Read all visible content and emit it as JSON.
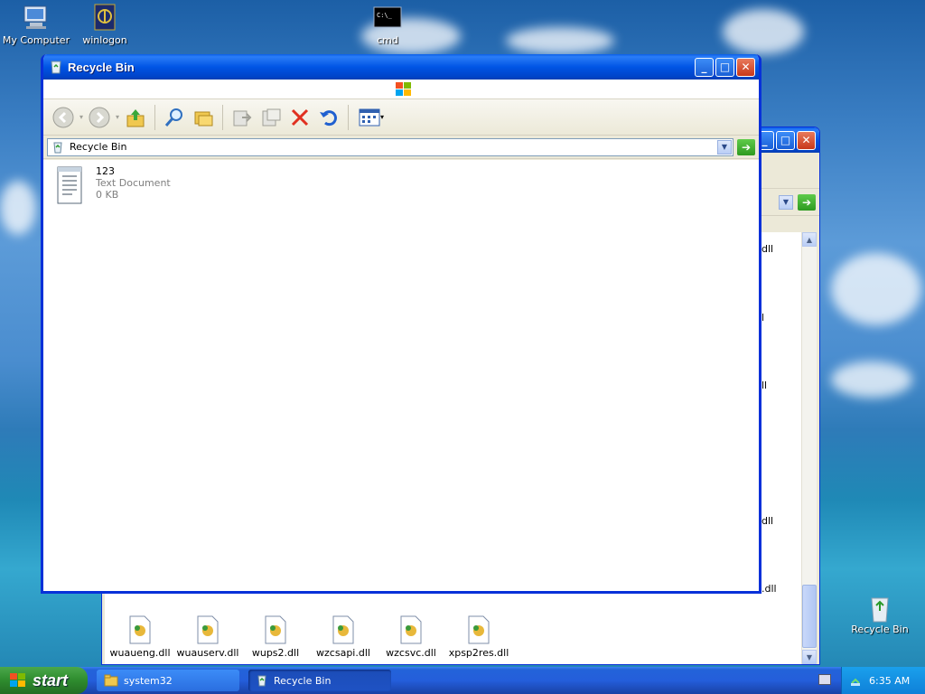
{
  "desktop": {
    "icons": [
      {
        "label": "My Computer",
        "icon": "my-computer-icon"
      },
      {
        "label": "winlogon",
        "icon": "winlogon-icon"
      },
      {
        "label": "cmd",
        "icon": "cmd-icon"
      },
      {
        "label": "Recycle Bin",
        "icon": "recycle-bin-icon"
      }
    ]
  },
  "back_window": {
    "title": "system32",
    "files": [
      {
        "name": "wuaueng.dll"
      },
      {
        "name": "wuauserv.dll"
      },
      {
        "name": "wups2.dll"
      },
      {
        "name": "wzcsapi.dll"
      },
      {
        "name": "wzcsvc.dll"
      },
      {
        "name": "xpsp2res.dll"
      }
    ],
    "partial_items": [
      {
        "text": "dll"
      },
      {
        "text": "l"
      },
      {
        "text": "ll"
      },
      {
        "text": "dll"
      },
      {
        "text": ".dll"
      }
    ]
  },
  "front_window": {
    "title": "Recycle Bin",
    "address": "Recycle Bin",
    "files": [
      {
        "name": "123",
        "type": "Text Document",
        "size": "0 KB"
      }
    ]
  },
  "taskbar": {
    "start_label": "start",
    "tasks": [
      {
        "label": "system32",
        "active": false
      },
      {
        "label": "Recycle Bin",
        "active": true
      }
    ],
    "clock": "6:35 AM"
  },
  "colors": {
    "xp_blue": "#0055e5",
    "start_green": "#2e8b2e",
    "tray_blue": "#0f80d8"
  }
}
